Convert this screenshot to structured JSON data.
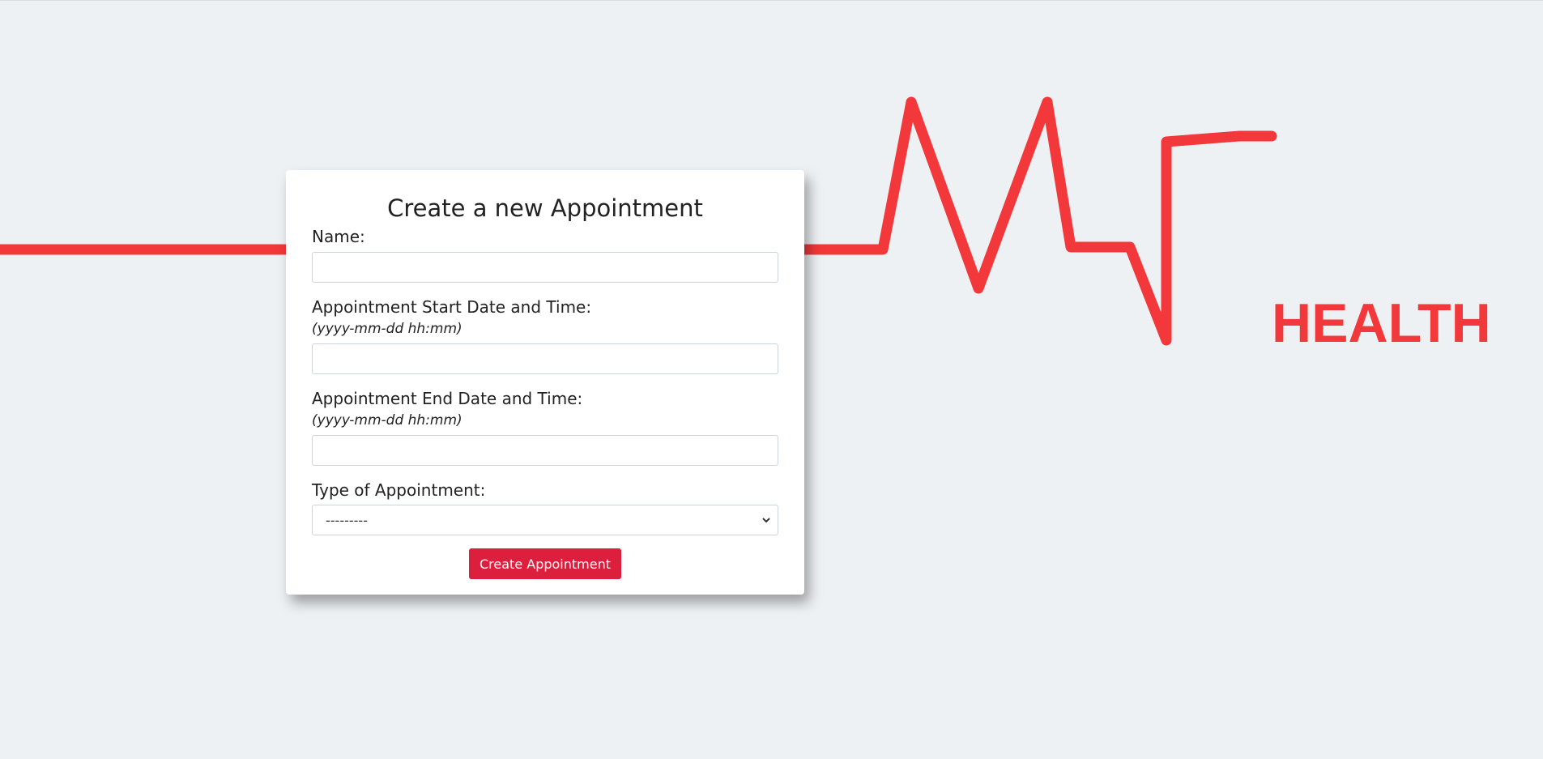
{
  "brand": {
    "logo_text": "HEALTH",
    "accent_color": "#f2383a",
    "button_color": "#dc1f3c"
  },
  "form": {
    "title": "Create a new Appointment",
    "name_label": "Name:",
    "name_value": "",
    "start_label": "Appointment Start Date and Time:",
    "start_hint": "(yyyy-mm-dd hh:mm)",
    "start_value": "",
    "end_label": "Appointment End Date and Time:",
    "end_hint": "(yyyy-mm-dd hh:mm)",
    "end_value": "",
    "type_label": "Type of Appointment:",
    "type_selected": "---------",
    "submit_label": "Create Appointment"
  }
}
